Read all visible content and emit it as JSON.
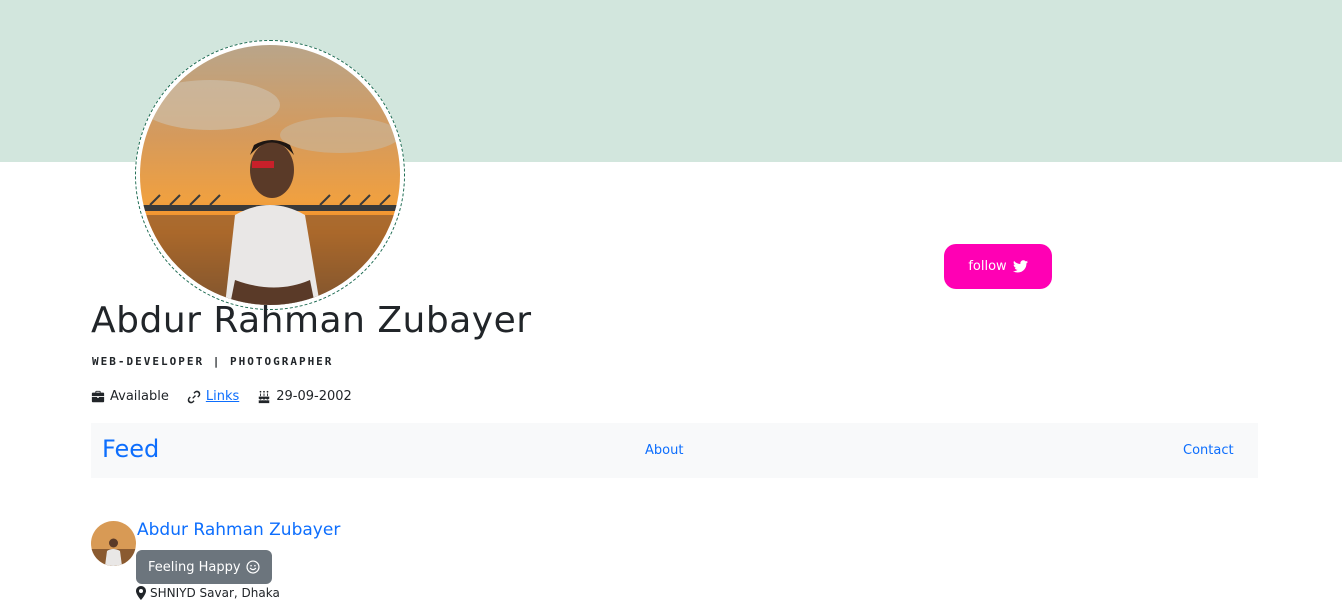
{
  "colors": {
    "cover": "#d2e6dd",
    "accent_pink": "#ff00b4",
    "link_blue": "#0d6efd",
    "badge_gray": "#6c757d",
    "navbar_bg": "#f8f9fa"
  },
  "profile": {
    "name": "Abdur Rahman Zubayer",
    "subtitle": "WEB-DEVELOPER | PHOTOGRAPHER",
    "avatar_icon": "profile-photo",
    "follow_label": "follow",
    "follow_icon": "twitter-icon"
  },
  "meta": {
    "status": "Available",
    "status_icon": "briefcase-icon",
    "links_label": "Links",
    "links_icon": "link-icon",
    "birthday": "29-09-2002",
    "birthday_icon": "birthday-cake-icon"
  },
  "nav": {
    "brand": "Feed",
    "about": "About",
    "contact": "Contact"
  },
  "post": {
    "author": "Abdur Rahman Zubayer",
    "feeling": "Feeling Happy",
    "feeling_icon": "smiley-icon",
    "location": "SHNIYD Savar, Dhaka",
    "location_icon": "map-marker-icon"
  }
}
